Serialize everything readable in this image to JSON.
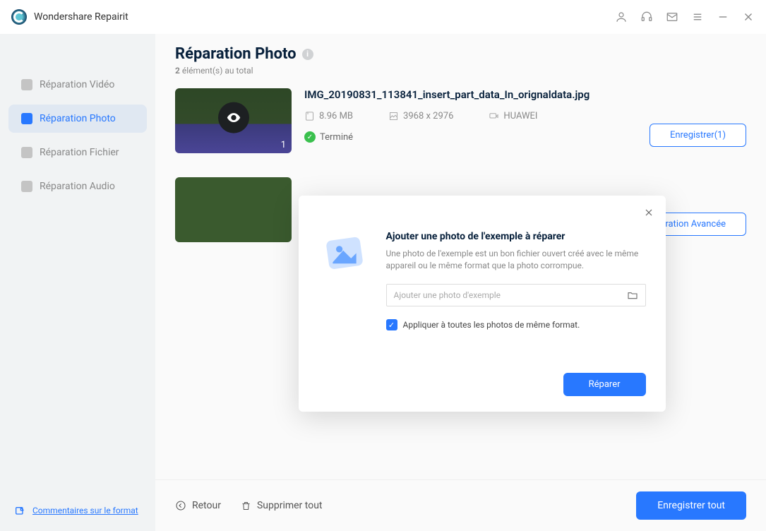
{
  "app_title": "Wondershare Repairit",
  "titlebar": {},
  "sidebar": {
    "items": [
      {
        "label": "Réparation Vidéo"
      },
      {
        "label": "Réparation Photo"
      },
      {
        "label": "Réparation Fichier"
      },
      {
        "label": "Réparation Audio"
      }
    ],
    "footer_link": "Commentaires sur le format"
  },
  "page": {
    "title": "Réparation Photo",
    "count": "2",
    "count_suffix": "  élément(s) au total"
  },
  "items": [
    {
      "thumb_badge": "1",
      "file_name": "IMG_20190831_113841_insert_part_data_In_orignaldata.jpg",
      "size": "8.96  MB",
      "dimensions": "3968 x 2976",
      "device": "HUAWEI",
      "status": "Terminé",
      "action": "Enregistrer(1)"
    },
    {
      "action": "Réparation Avancée"
    }
  ],
  "bottom": {
    "back": "Retour",
    "delete_all": "Supprimer tout",
    "save_all": "Enregistrer tout"
  },
  "modal": {
    "title": "Ajouter une photo de l'exemple à réparer",
    "description": "Une photo de l'exemple est un bon fichier ouvert créé avec le même appareil ou le même format que la photo corrompue.",
    "placeholder": "Ajouter une photo d'exemple",
    "checkbox_label": "Appliquer à toutes les photos de même format.",
    "submit": "Réparer"
  }
}
